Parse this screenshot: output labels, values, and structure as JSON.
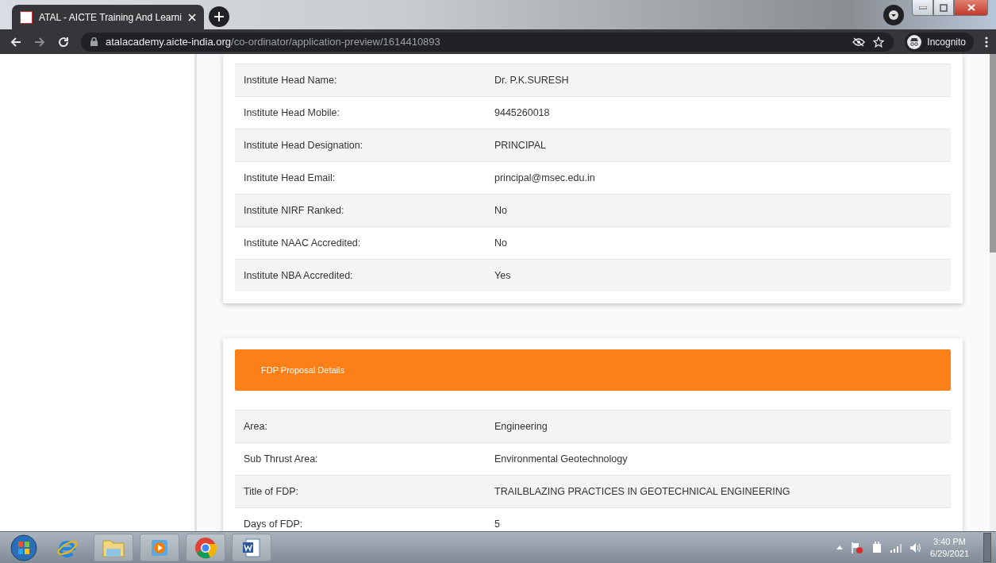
{
  "browser": {
    "tabs": [
      {
        "title": "ATAL - AICTE Training And Learni",
        "selected": true
      }
    ],
    "url_host": "atalacademy.aicte-india.org",
    "url_path": "/co-ordinator/application-preview/1614410893",
    "profile_label": "Incognito"
  },
  "institute_details": {
    "rows": [
      {
        "label": "Institute Head Name:",
        "value": "Dr. P.K.SURESH"
      },
      {
        "label": "Institute Head Mobile:",
        "value": "9445260018"
      },
      {
        "label": "Institute Head Designation:",
        "value": "PRINCIPAL"
      },
      {
        "label": "Institute Head Email:",
        "value": "principal@msec.edu.in"
      },
      {
        "label": "Institute NIRF Ranked:",
        "value": "No"
      },
      {
        "label": "Institute NAAC Accredited:",
        "value": "No"
      },
      {
        "label": "Institute NBA Accredited:",
        "value": "Yes"
      }
    ]
  },
  "fdp_proposal": {
    "title": "FDP Proposal Details",
    "rows": [
      {
        "label": "Area:",
        "value": "Engineering"
      },
      {
        "label": "Sub Thrust Area:",
        "value": "Environmental Geotechnology"
      },
      {
        "label": "Title of FDP:",
        "value": "TRAILBLAZING PRACTICES IN GEOTECHNICAL ENGINEERING"
      },
      {
        "label": "Days of FDP:",
        "value": "5"
      }
    ]
  },
  "taskbar": {
    "clock_time": "3:40 PM",
    "clock_date": "6/29/2021"
  }
}
